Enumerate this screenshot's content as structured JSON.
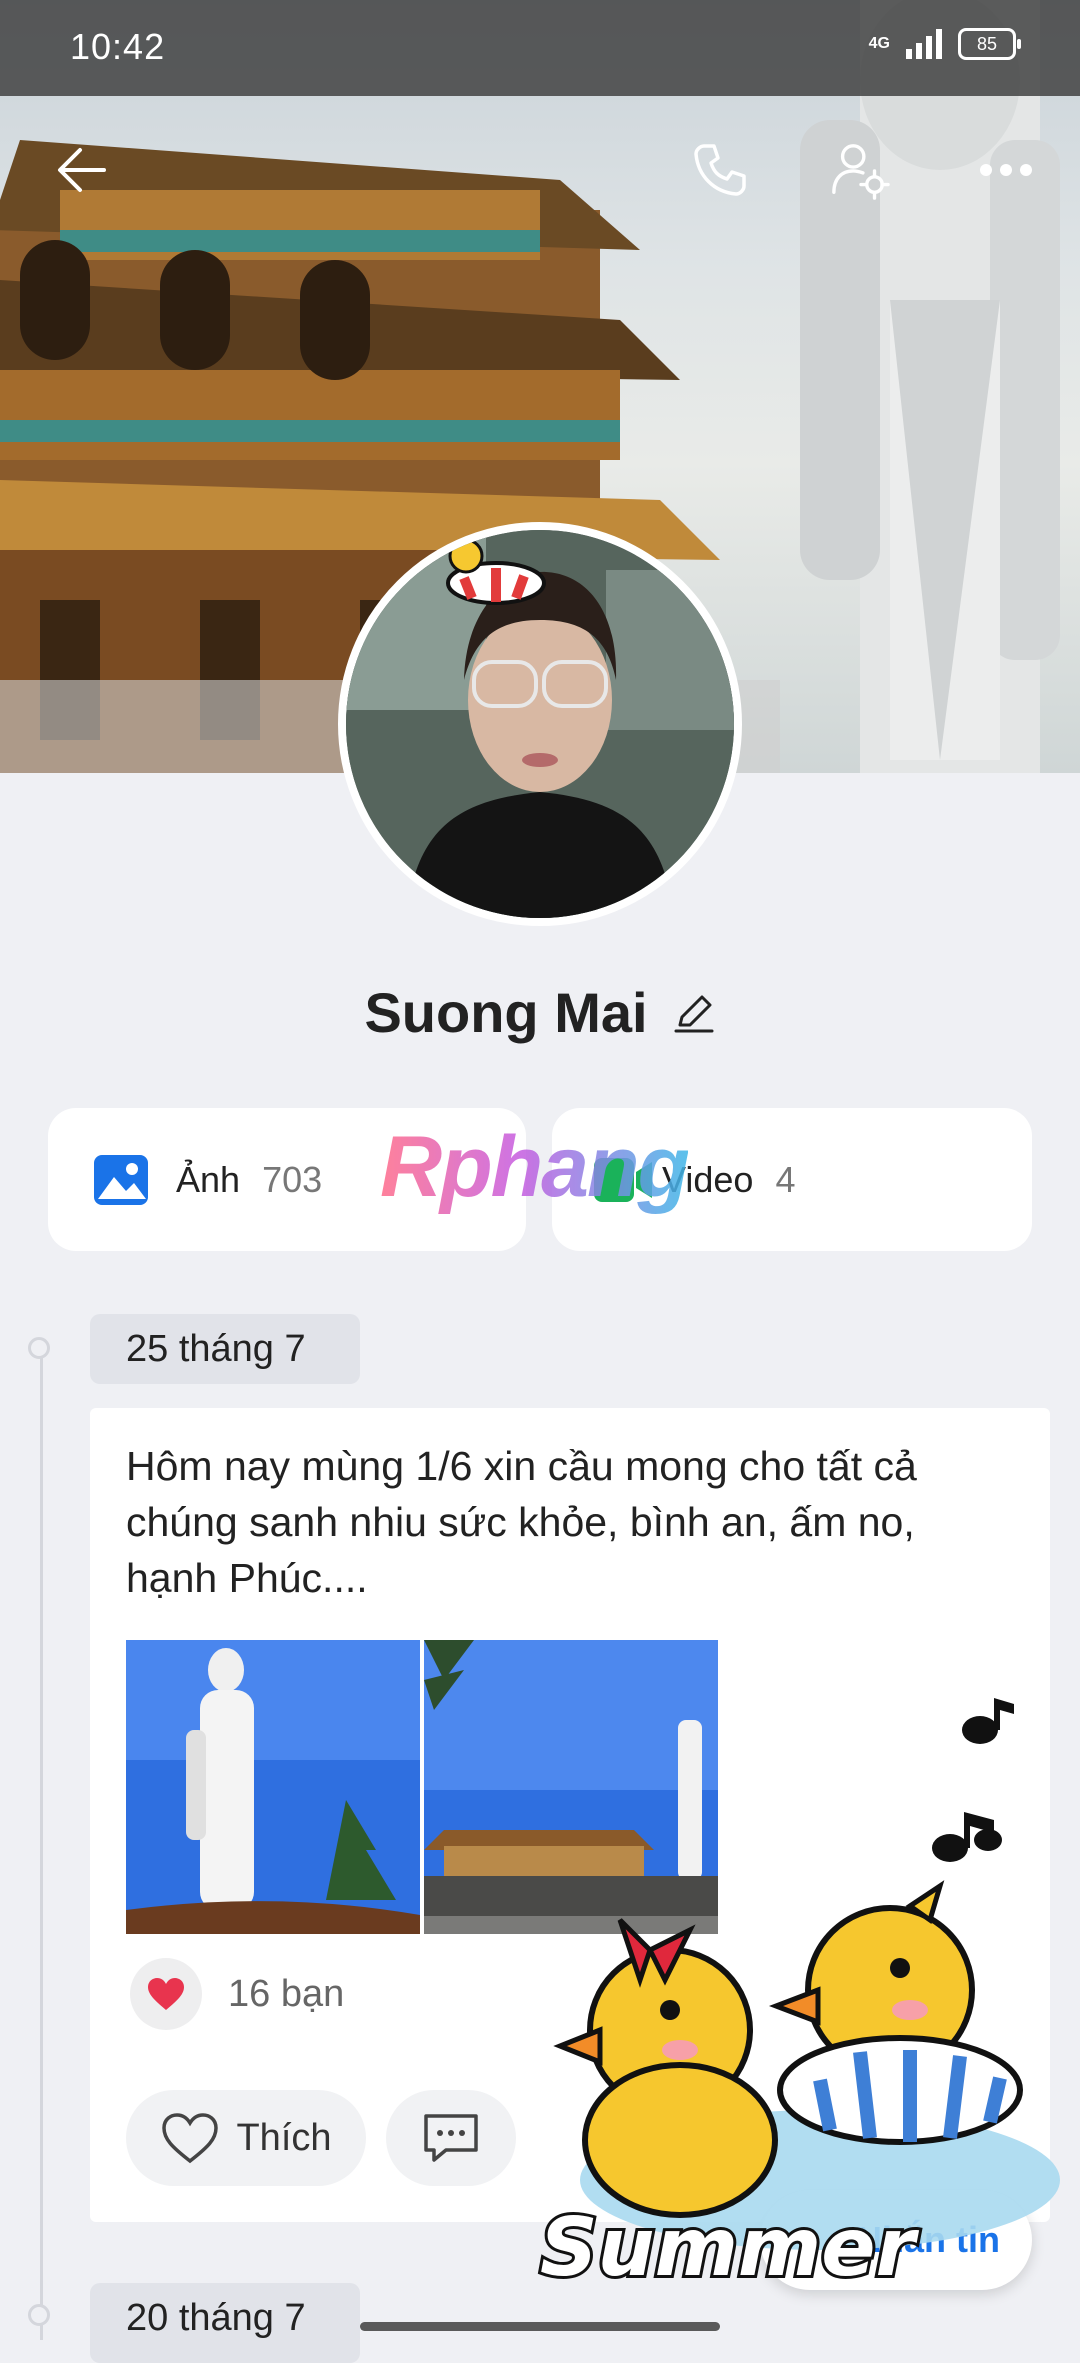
{
  "status_bar": {
    "time": "10:42",
    "network": "4G",
    "battery": "85"
  },
  "profile": {
    "name": "Suong Mai"
  },
  "media": {
    "photos": {
      "label": "Ảnh",
      "count": "703"
    },
    "videos": {
      "label": "Video",
      "count": "4"
    }
  },
  "watermark": "Rphang",
  "timeline": {
    "posts": [
      {
        "date": "25 tháng 7",
        "text": "Hôm nay mùng 1/6 xin cầu mong cho tất cả chúng sanh nhiu sức khỏe, bình an, ấm no, hạnh Phúc....",
        "reactions": "16 bạn",
        "like_label": "Thích"
      },
      {
        "date": "20 tháng 7"
      }
    ]
  },
  "message_button": {
    "label": "Nhắn tin"
  },
  "sticker_text": "Summer",
  "colors": {
    "accent": "#1a73e8",
    "heart": "#e8344e",
    "background": "#eff0f4"
  }
}
